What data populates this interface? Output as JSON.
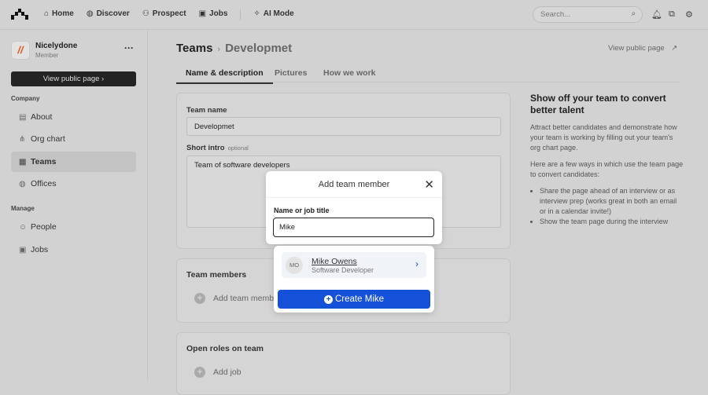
{
  "nav": {
    "items": [
      {
        "icon": "home-icon",
        "label": "Home"
      },
      {
        "icon": "globe-icon",
        "label": "Discover"
      },
      {
        "icon": "people-icon",
        "label": "Prospect"
      },
      {
        "icon": "briefcase-icon",
        "label": "Jobs"
      },
      {
        "icon": "ai-icon",
        "label": "AI Mode"
      }
    ],
    "search_placeholder": "Search..."
  },
  "sidebar": {
    "org_name": "Nicelydone",
    "org_role": "Member",
    "view_public": "View public page",
    "company_label": "Company",
    "company_items": [
      {
        "label": "About"
      },
      {
        "label": "Org chart"
      },
      {
        "label": "Teams"
      },
      {
        "label": "Offices"
      }
    ],
    "manage_label": "Manage",
    "manage_items": [
      {
        "label": "People"
      },
      {
        "label": "Jobs"
      }
    ]
  },
  "header": {
    "crumb": "Teams",
    "title": "Developmet",
    "view_public": "View public page"
  },
  "tabs": [
    "Name & description",
    "Pictures",
    "How we work"
  ],
  "form": {
    "team_name_label": "Team name",
    "team_name": "Developmet",
    "intro_label": "Short intro",
    "intro_optional": "optional",
    "intro": "Team of software developers"
  },
  "members": {
    "title": "Team members",
    "add": "Add team member"
  },
  "roles": {
    "title": "Open roles on team",
    "add": "Add job"
  },
  "aside": {
    "title": "Show off your team to convert better talent",
    "p1": "Attract better candidates and demonstrate how your team is working by filling out your team's org chart page.",
    "p2": "Here are a few ways in which use the team page to convert candidates:",
    "bullets": [
      "Share the page ahead of an interview or as interview prep (works great in both an email or in a calendar invite!)",
      "Show the team page during the interview"
    ]
  },
  "modal": {
    "title": "Add team member",
    "label": "Name or job title",
    "value": "Mike",
    "result": {
      "initials": "MO",
      "name": "Mike Owens",
      "role": "Software Developer"
    },
    "create": "Create Mike"
  }
}
